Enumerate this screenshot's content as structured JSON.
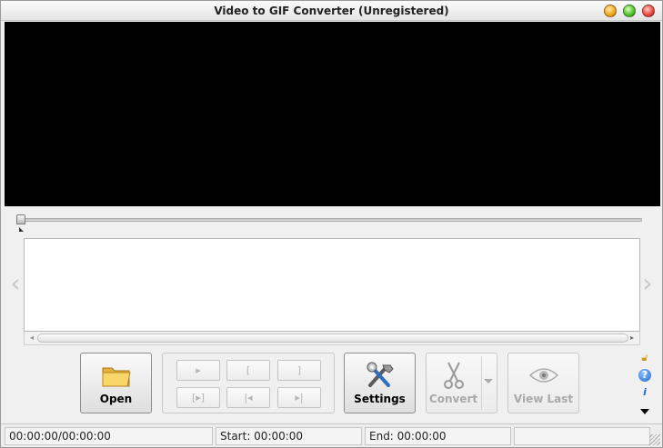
{
  "window": {
    "title": "Video to GIF Converter (Unregistered)"
  },
  "toolbar": {
    "open_label": "Open",
    "settings_label": "Settings",
    "convert_label": "Convert",
    "view_last_label": "View Last"
  },
  "playback_controls": [
    {
      "name": "play",
      "glyph": "▸"
    },
    {
      "name": "set-start",
      "glyph": "["
    },
    {
      "name": "set-end",
      "glyph": "]"
    },
    {
      "name": "play-selection",
      "glyph": "[▸]"
    },
    {
      "name": "go-start",
      "glyph": "|◂"
    },
    {
      "name": "go-end",
      "glyph": "▸|"
    }
  ],
  "status": {
    "position": "00:00:00/00:00:00",
    "start": "Start: 00:00:00",
    "end": "End: 00:00:00",
    "extra": ""
  },
  "icons": {
    "lock": "lock-icon",
    "help": "help-icon",
    "info": "info-icon"
  },
  "colors": {
    "video_background": "#000000",
    "window_background": "#f0f0f0"
  }
}
